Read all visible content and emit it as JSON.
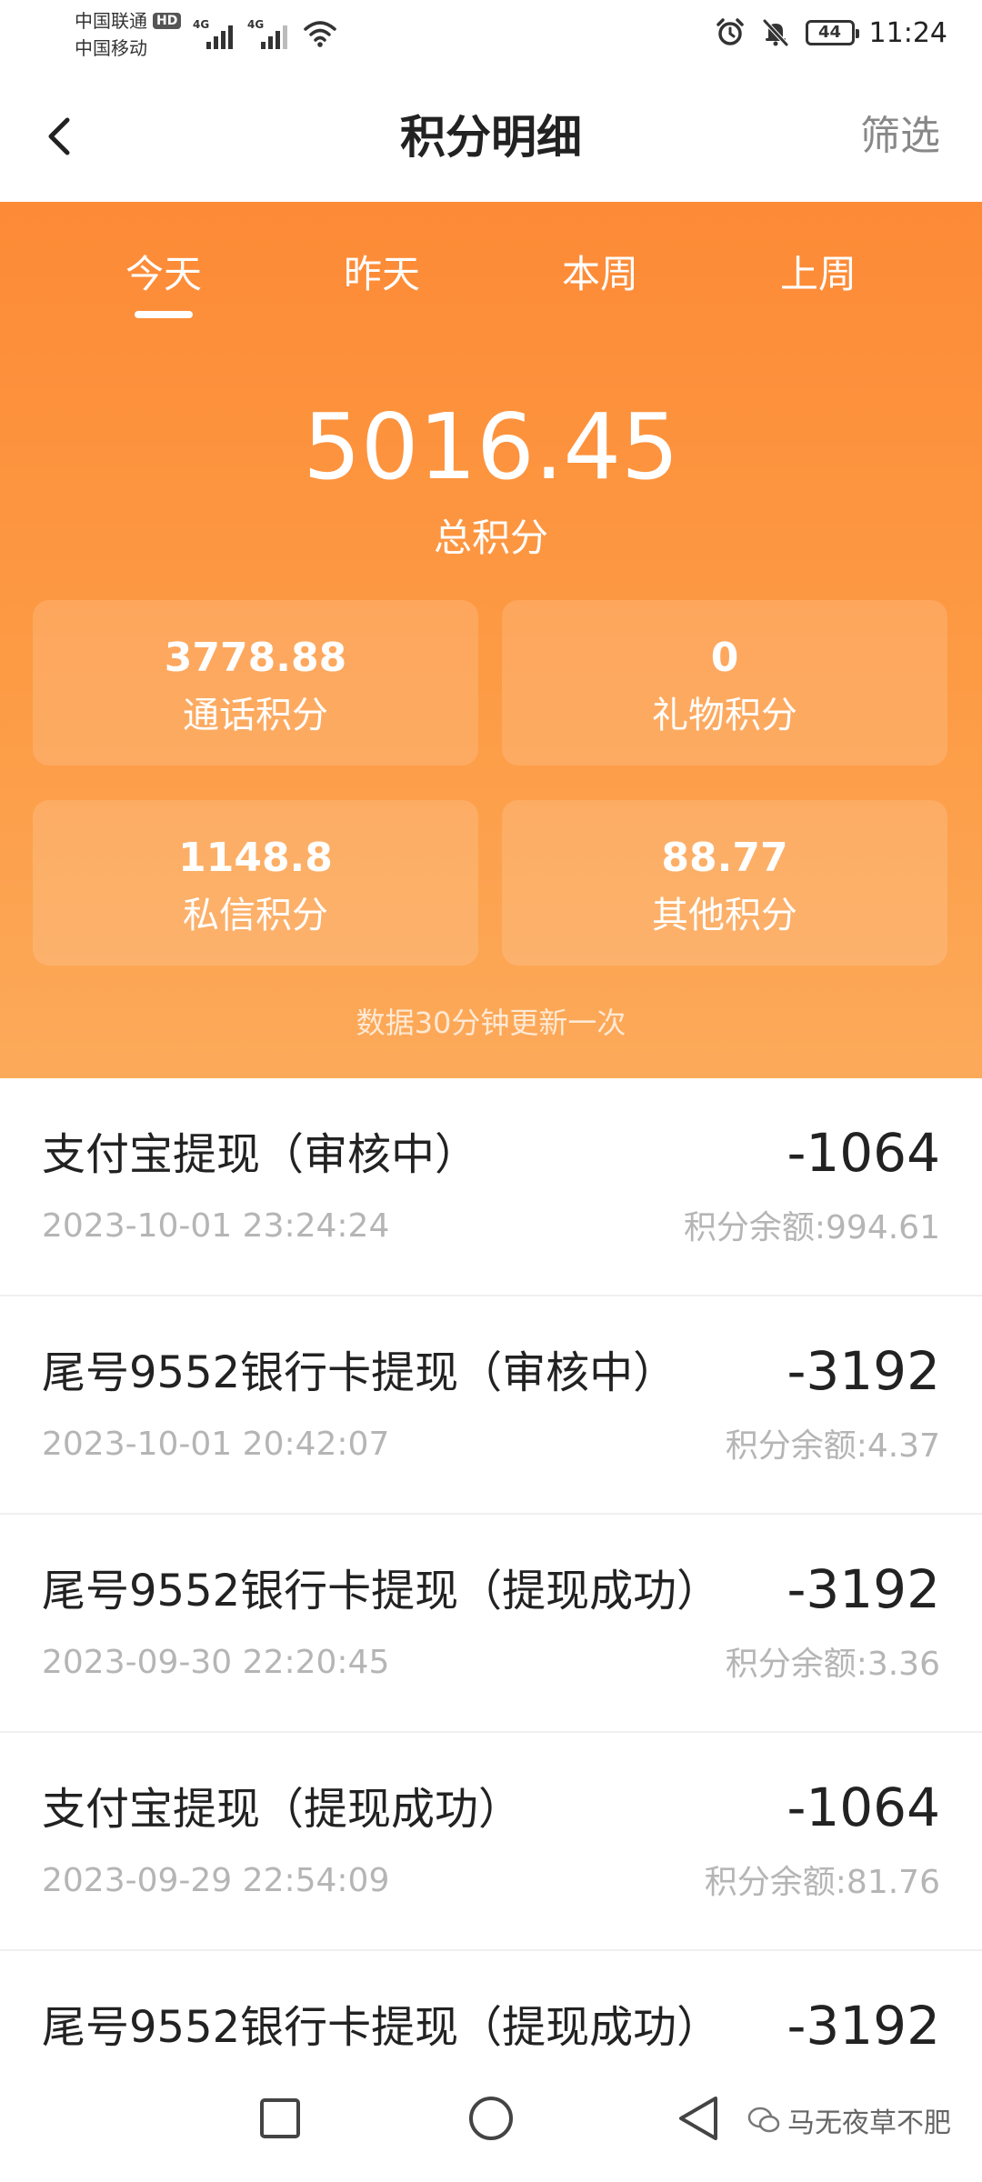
{
  "status_bar": {
    "carrier_1": "中国联通",
    "carrier_1_badge": "HD",
    "carrier_2": "中国移动",
    "network_1": "4G",
    "network_2": "4G",
    "battery": "44",
    "time": "11:24",
    "icons": [
      "alarm-icon",
      "mute-icon",
      "wifi-icon"
    ]
  },
  "header": {
    "title": "积分明细",
    "filter_label": "筛选",
    "back_icon": "back-icon"
  },
  "summary": {
    "tabs": [
      {
        "label": "今天",
        "active": true
      },
      {
        "label": "昨天",
        "active": false
      },
      {
        "label": "本周",
        "active": false
      },
      {
        "label": "上周",
        "active": false
      }
    ],
    "total_value": "5016.45",
    "total_label": "总积分",
    "stats": [
      {
        "value": "3778.88",
        "label": "通话积分"
      },
      {
        "value": "0",
        "label": "礼物积分"
      },
      {
        "value": "1148.8",
        "label": "私信积分"
      },
      {
        "value": "88.77",
        "label": "其他积分"
      }
    ],
    "update_note": "数据30分钟更新一次"
  },
  "records": [
    {
      "title": "支付宝提现（审核中）",
      "amount": "-1064",
      "time": "2023-10-01 23:24:24",
      "balance": "积分余额:994.61"
    },
    {
      "title": "尾号9552银行卡提现（审核中）",
      "amount": "-3192",
      "time": "2023-10-01 20:42:07",
      "balance": "积分余额:4.37"
    },
    {
      "title": "尾号9552银行卡提现（提现成功）",
      "amount": "-3192",
      "time": "2023-09-30 22:20:45",
      "balance": "积分余额:3.36"
    },
    {
      "title": "支付宝提现（提现成功）",
      "amount": "-1064",
      "time": "2023-09-29 22:54:09",
      "balance": "积分余额:81.76"
    },
    {
      "title": "尾号9552银行卡提现（提现成功）",
      "amount": "-3192",
      "time": "",
      "balance": ""
    }
  ],
  "nav_bar": {
    "buttons": [
      "recent-apps-icon",
      "home-icon",
      "back-nav-icon"
    ],
    "watermark": "马无夜草不肥"
  },
  "colors": {
    "accent_top": "#fd8a36",
    "accent_bottom": "#fcaa5a",
    "muted_text": "#b5b5b5",
    "filter_text": "#888888"
  }
}
